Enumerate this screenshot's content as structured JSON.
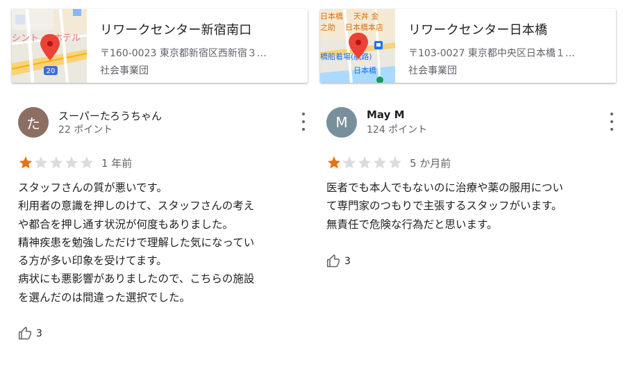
{
  "places": [
    {
      "name": "リワークセンター新宿南口",
      "address": "〒160-0023 東京都新宿区西新宿３…",
      "category": "社会事業団",
      "map_labels": [
        "シント",
        "ホテル",
        "20"
      ]
    },
    {
      "name": "リワークセンター日本橋",
      "address": "〒103-0027 東京都中央区日本橋１…",
      "category": "社会事業団",
      "map_labels": [
        "日本橋",
        "天丼 金",
        "之助",
        "日本橋本店",
        "橋船着場(航路)",
        "日本橋"
      ]
    }
  ],
  "reviews": [
    {
      "author": "スーパーたろうちゃん",
      "avatar_initial": "た",
      "avatar_color": "#8d6e63",
      "points": "22 ポイント",
      "rating": 1,
      "max_rating": 5,
      "ago": "1 年前",
      "lines": [
        "スタッフさんの質が悪いです。",
        "利用者の意識を押しのけて、スタッフさんの考え",
        "や都合を押し通す状況が何度もありました。",
        "精神疾患を勉強しただけで理解した気になってい",
        "る方が多い印象を受けてます。",
        "病状にも悪影響がありましたので、こちらの施設",
        "を選んだのは間違った選択でした。"
      ],
      "likes": "3"
    },
    {
      "author": "May M",
      "avatar_initial": "M",
      "avatar_color": "#78909c",
      "points": "124 ポイント",
      "rating": 1,
      "max_rating": 5,
      "ago": "5 か月前",
      "lines": [
        "医者でも本人でもないのに治療や薬の服用につい",
        "て専門家のつもりで主張するスタッフがいます。",
        "無責任で危険な行為だと思います。"
      ],
      "likes": "3"
    }
  ],
  "colors": {
    "star_filled": "#e8710a",
    "star_empty": "#dadce0",
    "icon_gray": "#5f6368",
    "map_pin": "#ea4335"
  },
  "icons": [
    "map-pin-icon",
    "more-vert-icon",
    "star-icon",
    "thumb-up-icon",
    "route-shield-icon",
    "ferry-icon"
  ]
}
